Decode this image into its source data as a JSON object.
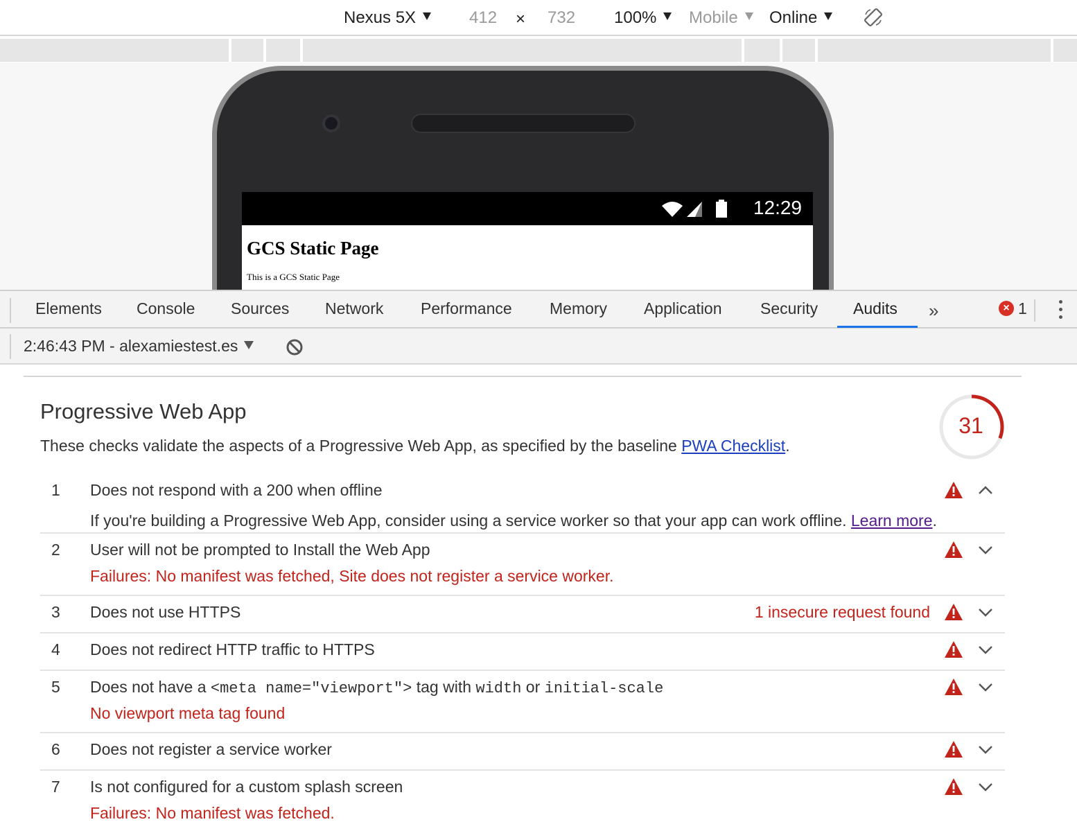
{
  "device_toolbar": {
    "device": "Nexus 5X",
    "width": "412",
    "times": "×",
    "height": "732",
    "zoom": "100%",
    "mode": "Mobile",
    "network": "Online"
  },
  "phone_page": {
    "status_time": "12:29",
    "heading": "GCS Static Page",
    "paragraph": "This is a GCS Static Page"
  },
  "devtools": {
    "tabs": [
      "Elements",
      "Console",
      "Sources",
      "Network",
      "Performance",
      "Memory",
      "Application",
      "Security",
      "Audits"
    ],
    "active_tab": "Audits",
    "more_tabs_glyph": "»",
    "error_badge": "×",
    "error_count": "1"
  },
  "audit_toolbar": {
    "run_label": "2:46:43 PM - alexamiestest.es"
  },
  "report": {
    "category_title": "Progressive Web App",
    "description_prefix": "These checks validate the aspects of a Progressive Web App, as specified by the baseline ",
    "description_link": "PWA Checklist",
    "description_suffix": ".",
    "score": "31",
    "score_fraction": 0.31,
    "score_color": "#c2241c",
    "audits": [
      {
        "index": "1",
        "title": "Does not respond with a 200 when offline",
        "expanded": true,
        "info_text": "If you're building a Progressive Web App, consider using a service worker so that your app can work offline. ",
        "info_link": "Learn more",
        "info_suffix": "."
      },
      {
        "index": "2",
        "title": "User will not be prompted to Install the Web App",
        "failure": "Failures: No manifest was fetched, Site does not register a service worker."
      },
      {
        "index": "3",
        "title": "Does not use HTTPS",
        "display_value": "1 insecure request found"
      },
      {
        "index": "4",
        "title": "Does not redirect HTTP traffic to HTTPS"
      },
      {
        "index": "5",
        "title_parts": [
          "Does not have a ",
          "<meta name=\"viewport\">",
          " tag with ",
          "width",
          " or ",
          "initial-scale"
        ],
        "failure": "No viewport meta tag found"
      },
      {
        "index": "6",
        "title": "Does not register a service worker"
      },
      {
        "index": "7",
        "title": "Is not configured for a custom splash screen",
        "failure": "Failures: No manifest was fetched."
      }
    ]
  },
  "icons": {
    "warning": "warning-triangle-icon",
    "expand": "chevron-down-icon",
    "collapse": "chevron-up-icon",
    "rotate": "rotate-device-icon",
    "clear": "block-clear-icon",
    "error": "error-circle-icon",
    "more": "more-vert-icon"
  },
  "colors": {
    "fail_red": "#c2241c",
    "active_tab_blue": "#1a73e8",
    "link_blue": "#1a3fbf",
    "visited_link": "#551a8b"
  }
}
